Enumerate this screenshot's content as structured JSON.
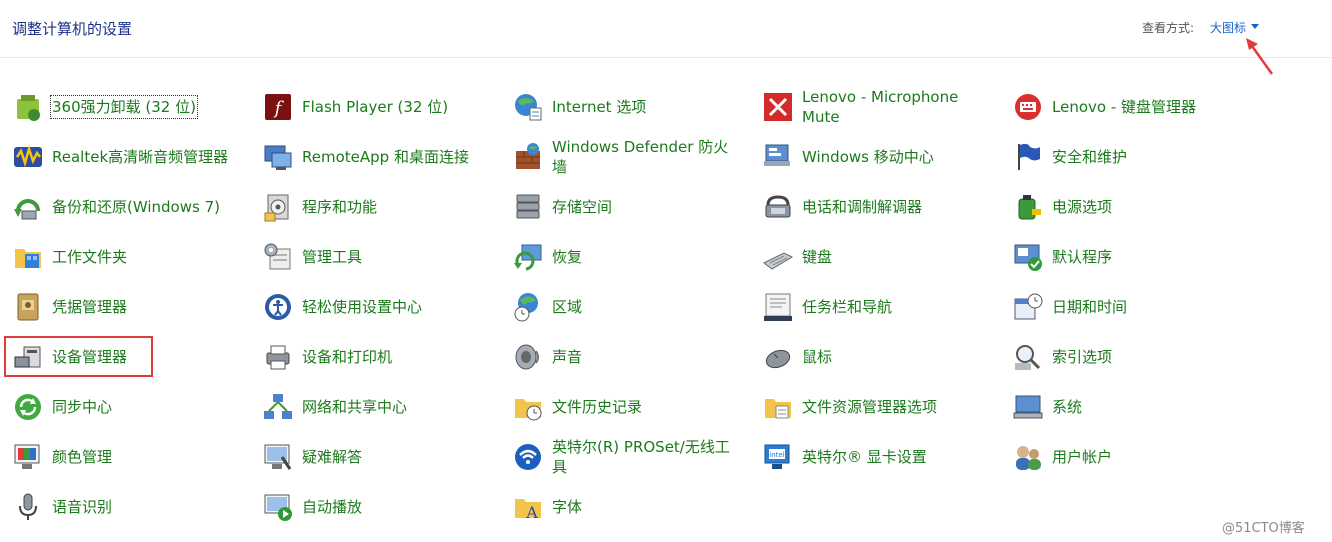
{
  "header": {
    "title": "调整计算机的设置",
    "view_label": "查看方式:",
    "view_value": "大图标"
  },
  "items": [
    {
      "label": "360强力卸载 (32 位)",
      "icon": "uninstall-icon"
    },
    {
      "label": "Flash Player (32 位)",
      "icon": "flash-icon"
    },
    {
      "label": "Internet 选项",
      "icon": "globe-options-icon"
    },
    {
      "label": "Lenovo - Microphone Mute",
      "icon": "mic-mute-icon"
    },
    {
      "label": "Lenovo - 键盘管理器",
      "icon": "keyboard-manager-icon"
    },
    {
      "label": "Realtek高清晰音频管理器",
      "icon": "realtek-audio-icon"
    },
    {
      "label": "RemoteApp 和桌面连接",
      "icon": "remoteapp-icon"
    },
    {
      "label": "Windows Defender 防火墙",
      "icon": "firewall-icon"
    },
    {
      "label": "Windows 移动中心",
      "icon": "mobility-center-icon"
    },
    {
      "label": "安全和维护",
      "icon": "flag-icon"
    },
    {
      "label": "备份和还原(Windows 7)",
      "icon": "backup-icon"
    },
    {
      "label": "程序和功能",
      "icon": "programs-icon"
    },
    {
      "label": "存储空间",
      "icon": "storage-icon"
    },
    {
      "label": "电话和调制解调器",
      "icon": "phone-modem-icon"
    },
    {
      "label": "电源选项",
      "icon": "power-icon"
    },
    {
      "label": "工作文件夹",
      "icon": "work-folder-icon"
    },
    {
      "label": "管理工具",
      "icon": "admin-tools-icon"
    },
    {
      "label": "恢复",
      "icon": "recovery-icon"
    },
    {
      "label": "键盘",
      "icon": "keyboard-icon"
    },
    {
      "label": "默认程序",
      "icon": "default-programs-icon"
    },
    {
      "label": "凭据管理器",
      "icon": "credential-icon"
    },
    {
      "label": "轻松使用设置中心",
      "icon": "ease-of-access-icon"
    },
    {
      "label": "区域",
      "icon": "region-icon"
    },
    {
      "label": "任务栏和导航",
      "icon": "taskbar-icon"
    },
    {
      "label": "日期和时间",
      "icon": "date-time-icon"
    },
    {
      "label": "设备管理器",
      "icon": "device-manager-icon"
    },
    {
      "label": "设备和打印机",
      "icon": "printer-icon"
    },
    {
      "label": "声音",
      "icon": "speaker-icon"
    },
    {
      "label": "鼠标",
      "icon": "mouse-icon"
    },
    {
      "label": "索引选项",
      "icon": "indexing-icon"
    },
    {
      "label": "同步中心",
      "icon": "sync-icon"
    },
    {
      "label": "网络和共享中心",
      "icon": "network-icon"
    },
    {
      "label": "文件历史记录",
      "icon": "file-history-icon"
    },
    {
      "label": "文件资源管理器选项",
      "icon": "explorer-options-icon"
    },
    {
      "label": "系统",
      "icon": "system-icon"
    },
    {
      "label": "颜色管理",
      "icon": "color-management-icon"
    },
    {
      "label": "疑难解答",
      "icon": "troubleshoot-icon"
    },
    {
      "label": "英特尔(R) PROSet/无线工具",
      "icon": "wireless-icon"
    },
    {
      "label": "英特尔® 显卡设置",
      "icon": "intel-graphics-icon"
    },
    {
      "label": "用户帐户",
      "icon": "user-accounts-icon"
    },
    {
      "label": "语音识别",
      "icon": "microphone-icon"
    },
    {
      "label": "自动播放",
      "icon": "autoplay-icon"
    },
    {
      "label": "字体",
      "icon": "font-icon"
    }
  ],
  "colors": {
    "link_green": "#1c7a1c",
    "title_blue": "#1e3287",
    "accent_blue": "#1a62c9",
    "annotation_red": "#e03c3c"
  },
  "watermark": "@51CTO博客"
}
